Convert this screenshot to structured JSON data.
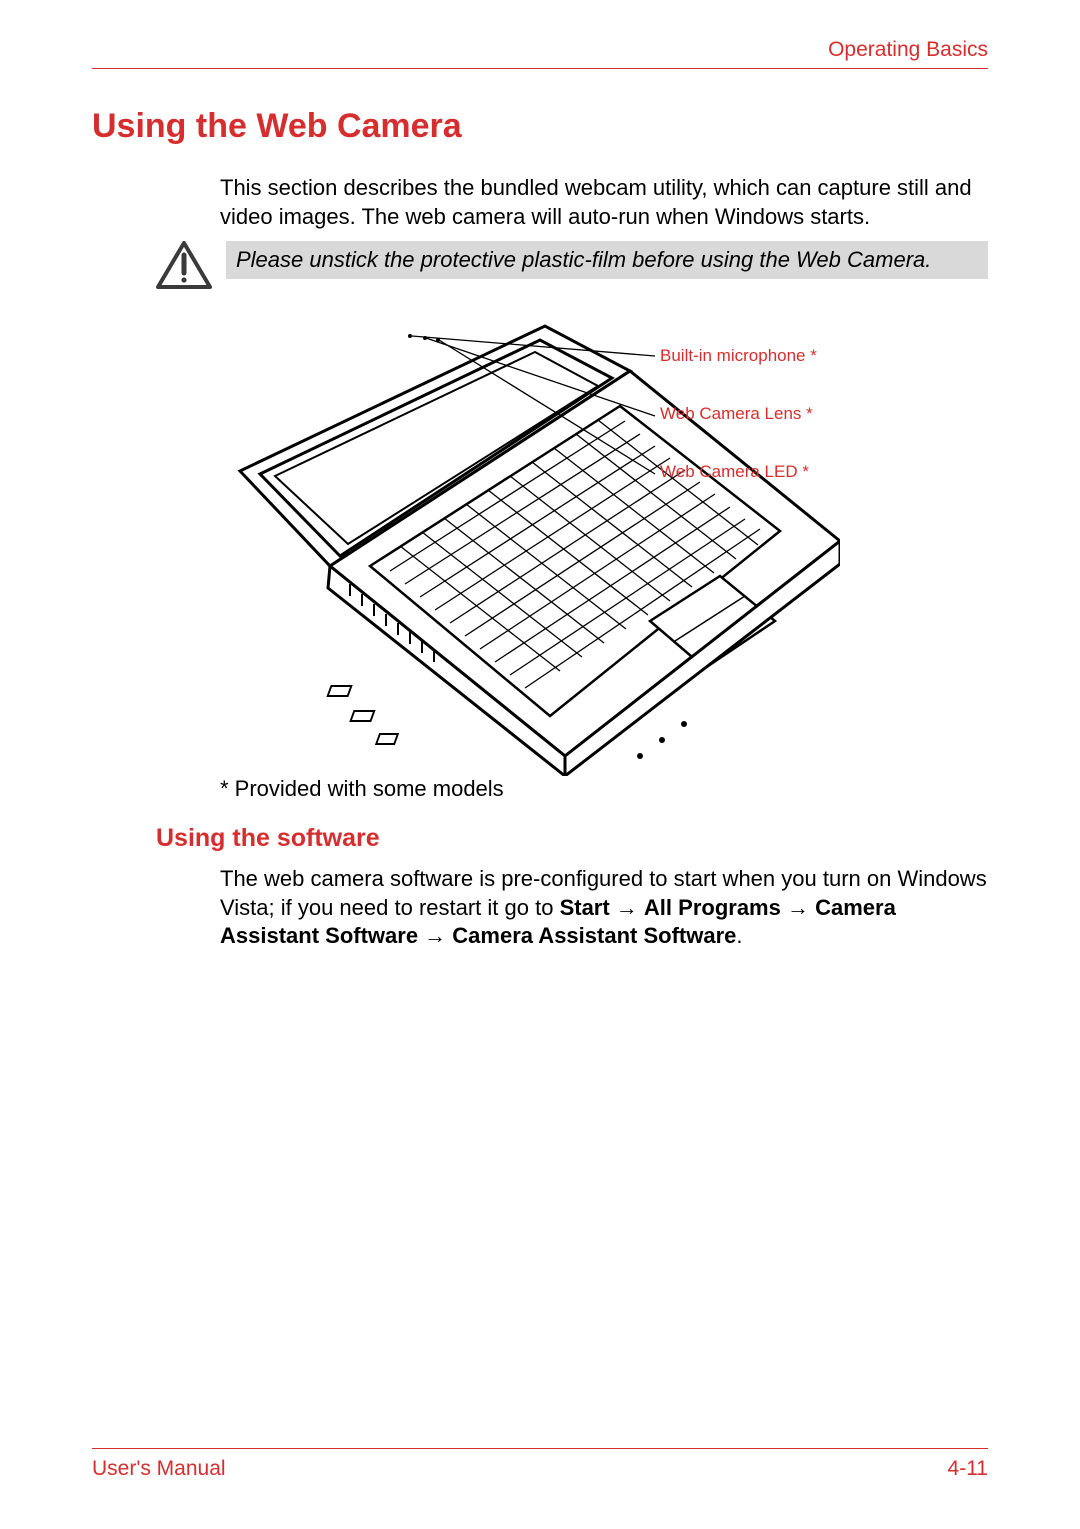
{
  "header": {
    "chapter": "Operating Basics"
  },
  "title": "Using the Web Camera",
  "intro": "This section describes the bundled webcam utility, which can capture still and video images. The web camera will auto-run when Windows starts.",
  "note": "Please unstick the protective plastic-film before using the Web Camera.",
  "callouts": {
    "mic": "Built-in microphone *",
    "lens": "Web Camera Lens *",
    "led": "Web Camera LED *"
  },
  "footnote": "* Provided with some models",
  "subheading": "Using the software",
  "software": {
    "prefix": "The web camera software is pre-configured to start when you turn on Windows Vista; if you need to restart it go to ",
    "path1": "Start",
    "path2": "All Programs",
    "path3": "Camera Assistant Software",
    "path4": "Camera Assistant Software",
    "arrow": " → ",
    "suffix": "."
  },
  "footer": {
    "left": "User's Manual",
    "right": "4-11"
  }
}
